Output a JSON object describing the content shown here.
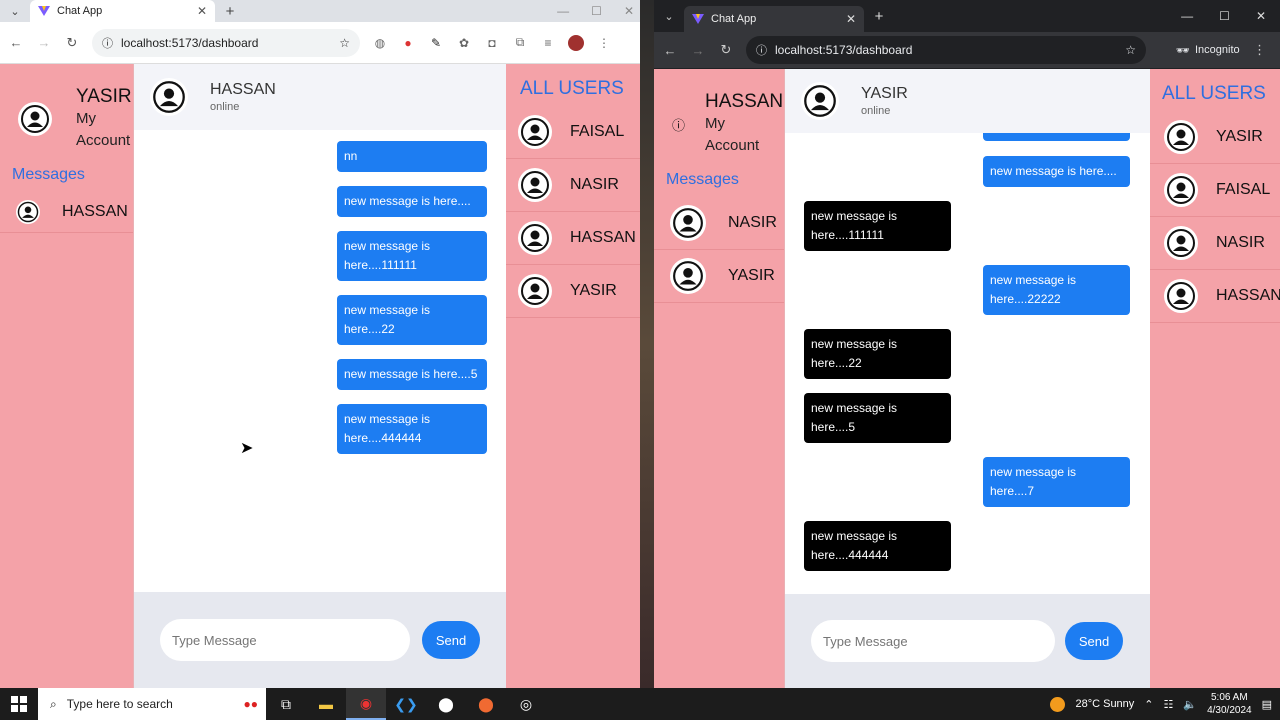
{
  "left_window": {
    "tab_title": "Chat App",
    "url": "localhost:5173/dashboard",
    "current_user": {
      "name": "YASIR",
      "subtitle_line1": "My",
      "subtitle_line2": "Account"
    },
    "messages_heading": "Messages",
    "conversations": [
      {
        "name": "HASSAN"
      }
    ],
    "chat_header": {
      "name": "HASSAN",
      "status": "online"
    },
    "messages": [
      {
        "text": "nn",
        "dir": "out"
      },
      {
        "text": "new message is here....",
        "dir": "out"
      },
      {
        "text": "new message is here....111111",
        "dir": "out"
      },
      {
        "text": "new message is here....22",
        "dir": "out"
      },
      {
        "text": "new message is here....5",
        "dir": "out"
      },
      {
        "text": "new message is here....444444",
        "dir": "out"
      }
    ],
    "input_placeholder": "Type Message",
    "send_label": "Send",
    "all_users_heading": "ALL USERS",
    "all_users": [
      "FAISAL",
      "NASIR",
      "HASSAN",
      "YASIR"
    ]
  },
  "right_window": {
    "tab_title": "Chat App",
    "url": "localhost:5173/dashboard",
    "incognito_label": "Incognito",
    "current_user": {
      "name": "HASSAN",
      "subtitle_line1": "My",
      "subtitle_line2": "Account"
    },
    "messages_heading": "Messages",
    "conversations": [
      {
        "name": "NASIR"
      },
      {
        "name": "YASIR"
      }
    ],
    "chat_header": {
      "name": "YASIR",
      "status": "online"
    },
    "messages": [
      {
        "text": "new message is here....",
        "dir": "out"
      },
      {
        "text": "new message is here....111111",
        "dir": "in"
      },
      {
        "text": "new message is here....22222",
        "dir": "out"
      },
      {
        "text": "new message is here....22",
        "dir": "in"
      },
      {
        "text": "new message is here....5",
        "dir": "in"
      },
      {
        "text": "new message is here....7",
        "dir": "out"
      },
      {
        "text": "new message is here....444444",
        "dir": "in"
      }
    ],
    "input_placeholder": "Type Message",
    "send_label": "Send",
    "all_users_heading": "ALL USERS",
    "all_users": [
      "YASIR",
      "FAISAL",
      "NASIR",
      "HASSAN"
    ]
  },
  "taskbar": {
    "search_placeholder": "Type here to search",
    "weather": "28°C  Sunny",
    "time": "5:06 AM",
    "date": "4/30/2024"
  },
  "colors": {
    "sidebar": "#f4a2a8",
    "accent_blue": "#1d7df2",
    "heading_blue": "#2f6fe0"
  }
}
